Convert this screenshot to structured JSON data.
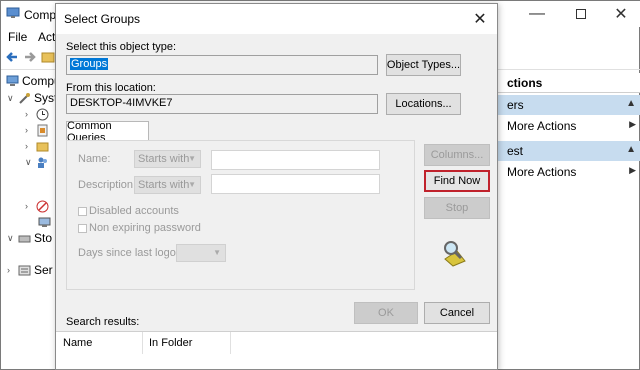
{
  "background_window": {
    "title": "Compu",
    "menu": [
      "File",
      "Actio"
    ],
    "tree": {
      "root_label": "Compu",
      "system_label": "Syst",
      "storage_label": "Sto",
      "services_label": "Ser"
    },
    "actions": {
      "header": "ctions",
      "section1_label": "ers",
      "more_actions_1": "More Actions",
      "section2_label": "est",
      "more_actions_2": "More Actions"
    }
  },
  "dialog": {
    "title": "Select Groups",
    "object_type_label": "Select this object type:",
    "object_type_value": "Groups",
    "object_types_button": "Object Types...",
    "location_label": "From this location:",
    "location_value": "DESKTOP-4IMVKE7",
    "locations_button": "Locations...",
    "tab_label": "Common Queries",
    "name_label": "Name:",
    "name_combo": "Starts with",
    "description_label": "Description:",
    "description_combo": "Starts with",
    "disabled_accounts_label": "Disabled accounts",
    "non_expiring_label": "Non expiring password",
    "days_label": "Days since last logon:",
    "columns_button": "Columns...",
    "find_now_button": "Find Now",
    "stop_button": "Stop",
    "ok_button": "OK",
    "cancel_button": "Cancel",
    "search_results_label": "Search results:",
    "col_name": "Name",
    "col_in_folder": "In Folder"
  },
  "colors": {
    "selection": "#0078d7",
    "find_now_highlight": "#c0222c",
    "actions_section_bg": "#c7dcef"
  }
}
